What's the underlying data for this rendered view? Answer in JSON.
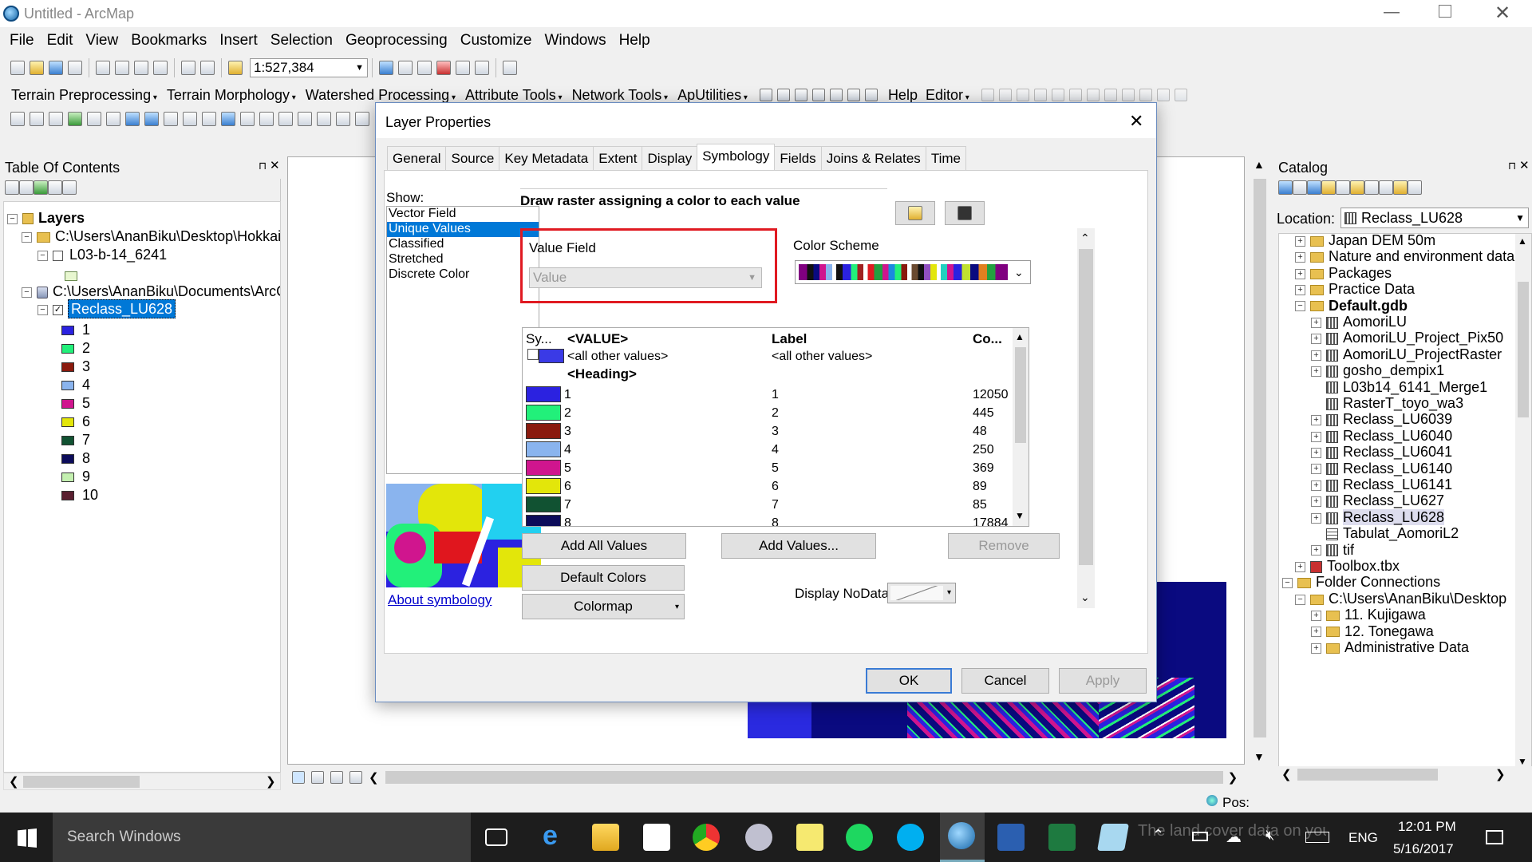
{
  "window": {
    "title": "Untitled - ArcMap"
  },
  "menu": [
    "File",
    "Edit",
    "View",
    "Bookmarks",
    "Insert",
    "Selection",
    "Geoprocessing",
    "Customize",
    "Windows",
    "Help"
  ],
  "toolbar": {
    "scale": "1:527,384"
  },
  "toolbar2": [
    "Terrain Preprocessing",
    "Terrain Morphology",
    "Watershed Processing",
    "Attribute Tools",
    "Network Tools",
    "ApUtilities"
  ],
  "toolbar2_help": "Help",
  "toolbar2_editor": "Editor",
  "toc": {
    "title": "Table Of Contents",
    "layers_label": "Layers",
    "group1_path": "C:\\Users\\AnanBiku\\Desktop\\Hokkaido",
    "group1_layer": "L03-b-14_6241",
    "group2_path": "C:\\Users\\AnanBiku\\Documents\\ArcGIS",
    "group2_layer": "Reclass_LU628",
    "legend": [
      {
        "label": "1",
        "color": "#2b22e0"
      },
      {
        "label": "2",
        "color": "#22f07a"
      },
      {
        "label": "3",
        "color": "#8a1a0e"
      },
      {
        "label": "4",
        "color": "#8ab4ee"
      },
      {
        "label": "5",
        "color": "#d0158e"
      },
      {
        "label": "6",
        "color": "#e3e60a"
      },
      {
        "label": "7",
        "color": "#115232"
      },
      {
        "label": "8",
        "color": "#0c0c5a"
      },
      {
        "label": "9",
        "color": "#c4f0b0"
      },
      {
        "label": "10",
        "color": "#5a2030"
      }
    ]
  },
  "dialog": {
    "title": "Layer Properties",
    "tabs": [
      "General",
      "Source",
      "Key Metadata",
      "Extent",
      "Display",
      "Symbology",
      "Fields",
      "Joins & Relates",
      "Time"
    ],
    "active_tab": "Symbology",
    "show_label": "Show:",
    "show_options": [
      "Vector Field",
      "Unique Values",
      "Classified",
      "Stretched",
      "Discrete Color"
    ],
    "selected_show": "Unique Values",
    "heading": "Draw raster assigning a color to each value",
    "value_field_label": "Value Field",
    "value_field_value": "Value",
    "color_scheme_label": "Color Scheme",
    "table_headers": [
      "Sy...",
      "<VALUE>",
      "Label",
      "Co..."
    ],
    "other_values": "<all other values>",
    "other_values_label": "<all other values>",
    "heading_row": "<Heading>",
    "rows": [
      {
        "value": "1",
        "label": "1",
        "count": "12050",
        "color": "#2b22e0"
      },
      {
        "value": "2",
        "label": "2",
        "count": "445",
        "color": "#22f07a"
      },
      {
        "value": "3",
        "label": "3",
        "count": "48",
        "color": "#8a1a0e"
      },
      {
        "value": "4",
        "label": "4",
        "count": "250",
        "color": "#8ab4ee"
      },
      {
        "value": "5",
        "label": "5",
        "count": "369",
        "color": "#d0158e"
      },
      {
        "value": "6",
        "label": "6",
        "count": "89",
        "color": "#e3e60a"
      },
      {
        "value": "7",
        "label": "7",
        "count": "85",
        "color": "#115232"
      },
      {
        "value": "8",
        "label": "8",
        "count": "17884",
        "color": "#0c0c5a"
      }
    ],
    "add_all_values": "Add All Values",
    "add_values": "Add Values...",
    "remove": "Remove",
    "default_colors": "Default Colors",
    "colormap": "Colormap",
    "about_symbology": "About symbology",
    "display_nodata": "Display NoData as",
    "ok": "OK",
    "cancel": "Cancel",
    "apply": "Apply"
  },
  "catalog": {
    "title": "Catalog",
    "location_label": "Location:",
    "location_value": "Reclass_LU628",
    "items": [
      {
        "label": "Japan DEM 50m",
        "kind": "folder",
        "indent": 0
      },
      {
        "label": "Nature and environment data",
        "kind": "folder",
        "indent": 0
      },
      {
        "label": "Packages",
        "kind": "folder",
        "indent": 0
      },
      {
        "label": "Practice Data",
        "kind": "folder",
        "indent": 0
      },
      {
        "label": "Default.gdb",
        "kind": "gdb",
        "indent": 0
      },
      {
        "label": "AomoriLU",
        "kind": "raster",
        "indent": 1
      },
      {
        "label": "AomoriLU_Project_Pix50",
        "kind": "raster",
        "indent": 1
      },
      {
        "label": "AomoriLU_ProjectRaster",
        "kind": "raster",
        "indent": 1
      },
      {
        "label": "gosho_dempix1",
        "kind": "raster",
        "indent": 1
      },
      {
        "label": "L03b14_6141_Merge1",
        "kind": "raster",
        "indent": 1
      },
      {
        "label": "RasterT_toyo_wa3",
        "kind": "raster",
        "indent": 1
      },
      {
        "label": "Reclass_LU6039",
        "kind": "raster",
        "indent": 1
      },
      {
        "label": "Reclass_LU6040",
        "kind": "raster",
        "indent": 1
      },
      {
        "label": "Reclass_LU6041",
        "kind": "raster",
        "indent": 1
      },
      {
        "label": "Reclass_LU6140",
        "kind": "raster",
        "indent": 1
      },
      {
        "label": "Reclass_LU6141",
        "kind": "raster",
        "indent": 1
      },
      {
        "label": "Reclass_LU627",
        "kind": "raster",
        "indent": 1
      },
      {
        "label": "Reclass_LU628",
        "kind": "raster",
        "indent": 1
      },
      {
        "label": "Tabulat_AomoriL2",
        "kind": "table",
        "indent": 1
      },
      {
        "label": "tif",
        "kind": "raster",
        "indent": 1
      },
      {
        "label": "Toolbox.tbx",
        "kind": "toolbox",
        "indent": 0
      },
      {
        "label": "Folder Connections",
        "kind": "folder",
        "indent": -1
      },
      {
        "label": "C:\\Users\\AnanBiku\\Desktop",
        "kind": "folder",
        "indent": 0
      },
      {
        "label": "11. Kujigawa",
        "kind": "folder",
        "indent": 1
      },
      {
        "label": "12. Tonegawa",
        "kind": "folder",
        "indent": 1
      },
      {
        "label": "Administrative Data",
        "kind": "folder",
        "indent": 1
      }
    ]
  },
  "status": {
    "pos": "Pos:"
  },
  "taskbar": {
    "search": "Search Windows",
    "lang": "ENG",
    "time": "12:01 PM",
    "date": "5/16/2017",
    "overlay_text": "The land cover data on your screen"
  }
}
